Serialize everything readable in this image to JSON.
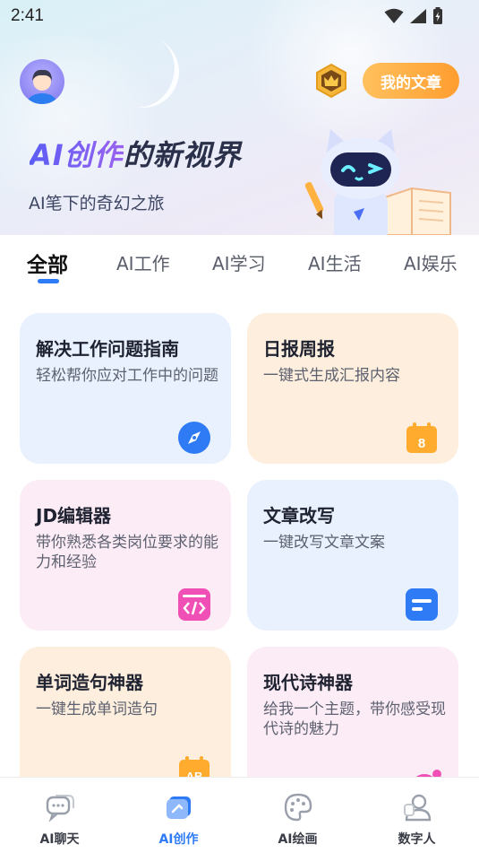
{
  "status_bar": {
    "time": "2:41"
  },
  "header": {
    "my_articles_label": "我的文章",
    "title_gradient": "AI创作",
    "title_rest": "的新视界",
    "subtitle": "AI笔下的奇幻之旅"
  },
  "tabs": [
    {
      "label": "全部",
      "active": true
    },
    {
      "label": "AI工作",
      "active": false
    },
    {
      "label": "AI学习",
      "active": false
    },
    {
      "label": "AI生活",
      "active": false
    },
    {
      "label": "AI娱乐",
      "active": false
    }
  ],
  "cards": [
    {
      "title": "解决工作问题指南",
      "desc": "轻松帮你应对工作中的问题",
      "icon": "compass-icon"
    },
    {
      "title": "日报周报",
      "desc": "一键式生成汇报内容",
      "icon": "calendar-icon"
    },
    {
      "title": "JD编辑器",
      "desc": "带你熟悉各类岗位要求的能力和经验",
      "icon": "code-icon"
    },
    {
      "title": "文章改写",
      "desc": "一键改写文章文案",
      "icon": "document-icon"
    },
    {
      "title": "单词造句神器",
      "desc": "一键生成单词造句",
      "icon": "ab-calendar-icon",
      "icon_text": "AB"
    },
    {
      "title": "现代诗神器",
      "desc": "给我一个主题，带你感受现代诗的魅力",
      "icon": "poem-icon"
    }
  ],
  "calendar_icon_text": "8",
  "bottom_nav": [
    {
      "label": "AI聊天",
      "icon": "chat-icon",
      "active": false
    },
    {
      "label": "AI创作",
      "icon": "creation-icon",
      "active": true
    },
    {
      "label": "AI绘画",
      "icon": "palette-icon",
      "active": false
    },
    {
      "label": "数字人",
      "icon": "digital-human-icon",
      "active": false
    }
  ],
  "colors": {
    "accent": "#2f7bf6",
    "orange_button": "#ff9d2f",
    "card_blue": "#e8f1fd",
    "card_peach": "#fdeedd",
    "card_pink": "#fcecf6"
  }
}
